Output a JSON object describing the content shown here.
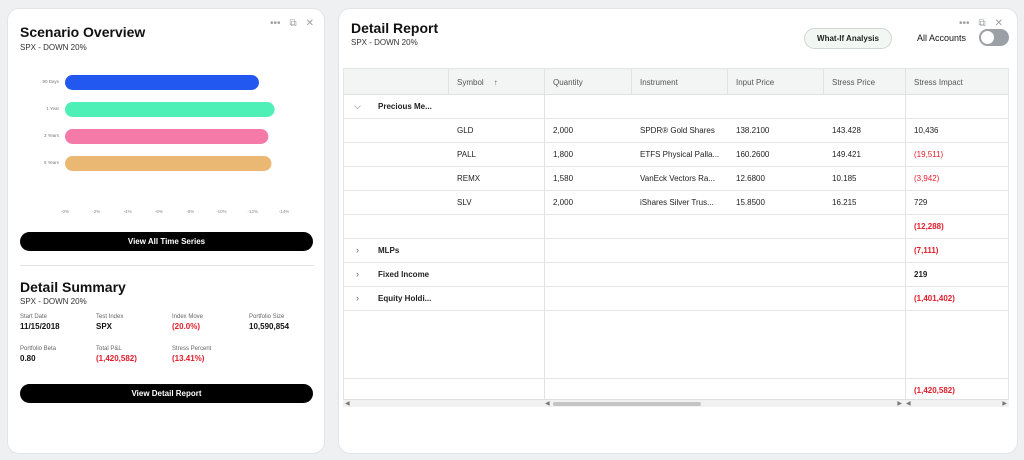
{
  "scenario": {
    "title": "Scenario Overview",
    "subtitle": "SPX - DOWN 20%",
    "button": "View All Time Series"
  },
  "chart_data": {
    "type": "bar",
    "orientation": "horizontal",
    "categories": [
      "90 Days",
      "1 Year",
      "3 Years",
      "5 Years"
    ],
    "values": [
      -12.4,
      -13.4,
      -13.0,
      -13.2
    ],
    "colors": [
      "#2358f0",
      "#4ff0b8",
      "#f57aa8",
      "#ebb874"
    ],
    "xticks": [
      "-0%",
      "-2%",
      "-4%",
      "-6%",
      "-8%",
      "-10%",
      "-12%",
      "-14%"
    ],
    "xlim": [
      0,
      -14
    ],
    "title": "",
    "xlabel": "",
    "ylabel": ""
  },
  "summary": {
    "title": "Detail Summary",
    "subtitle": "SPX - DOWN 20%",
    "button": "View Detail Report",
    "items": [
      {
        "label": "Start Date",
        "value": "11/15/2018",
        "neg": false
      },
      {
        "label": "Test Index",
        "value": "SPX",
        "neg": false
      },
      {
        "label": "Index Move",
        "value": "(20.0%)",
        "neg": true
      },
      {
        "label": "Portfolio Size",
        "value": "10,590,854",
        "neg": false
      },
      {
        "label": "Portfolio Beta",
        "value": "0.80",
        "neg": false
      },
      {
        "label": "Total P&L",
        "value": "(1,420,582)",
        "neg": true
      },
      {
        "label": "Stress Percent",
        "value": "(13.41%)",
        "neg": true
      }
    ]
  },
  "report": {
    "title": "Detail Report",
    "subtitle": "SPX - DOWN 20%",
    "whatif": "What-If Analysis",
    "all_accounts": "All Accounts",
    "columns": [
      "Symbol",
      "Quantity",
      "Instrument",
      "Input Price",
      "Stress Price",
      "Stress Impact"
    ],
    "sort_icon": "↑",
    "groups": {
      "precious": {
        "label": "Precious Me...",
        "subtotal": "(12,288)"
      },
      "mlps": {
        "label": "MLPs",
        "total": "(7,111)"
      },
      "fixed": {
        "label": "Fixed Income",
        "total": "219"
      },
      "equity": {
        "label": "Equity Holdi...",
        "total": "(1,401,402)"
      }
    },
    "rows": [
      {
        "symbol": "GLD",
        "quantity": "2,000",
        "instrument": "SPDR® Gold Shares",
        "input": "138.2100",
        "stress": "143.428",
        "impact": "10,436",
        "neg": false
      },
      {
        "symbol": "PALL",
        "quantity": "1,800",
        "instrument": "ETFS Physical Palla...",
        "input": "160.2600",
        "stress": "149.421",
        "impact": "(19,511)",
        "neg": true
      },
      {
        "symbol": "REMX",
        "quantity": "1,580",
        "instrument": "VanEck Vectors Ra...",
        "input": "12.6800",
        "stress": "10.185",
        "impact": "(3,942)",
        "neg": true
      },
      {
        "symbol": "SLV",
        "quantity": "2,000",
        "instrument": "iShares Silver Trus...",
        "input": "15.8500",
        "stress": "16.215",
        "impact": "729",
        "neg": false
      }
    ],
    "grand_total": "(1,420,582)"
  },
  "icons": {
    "more": "more-icon",
    "popout": "popout-icon",
    "close": "close-icon"
  }
}
